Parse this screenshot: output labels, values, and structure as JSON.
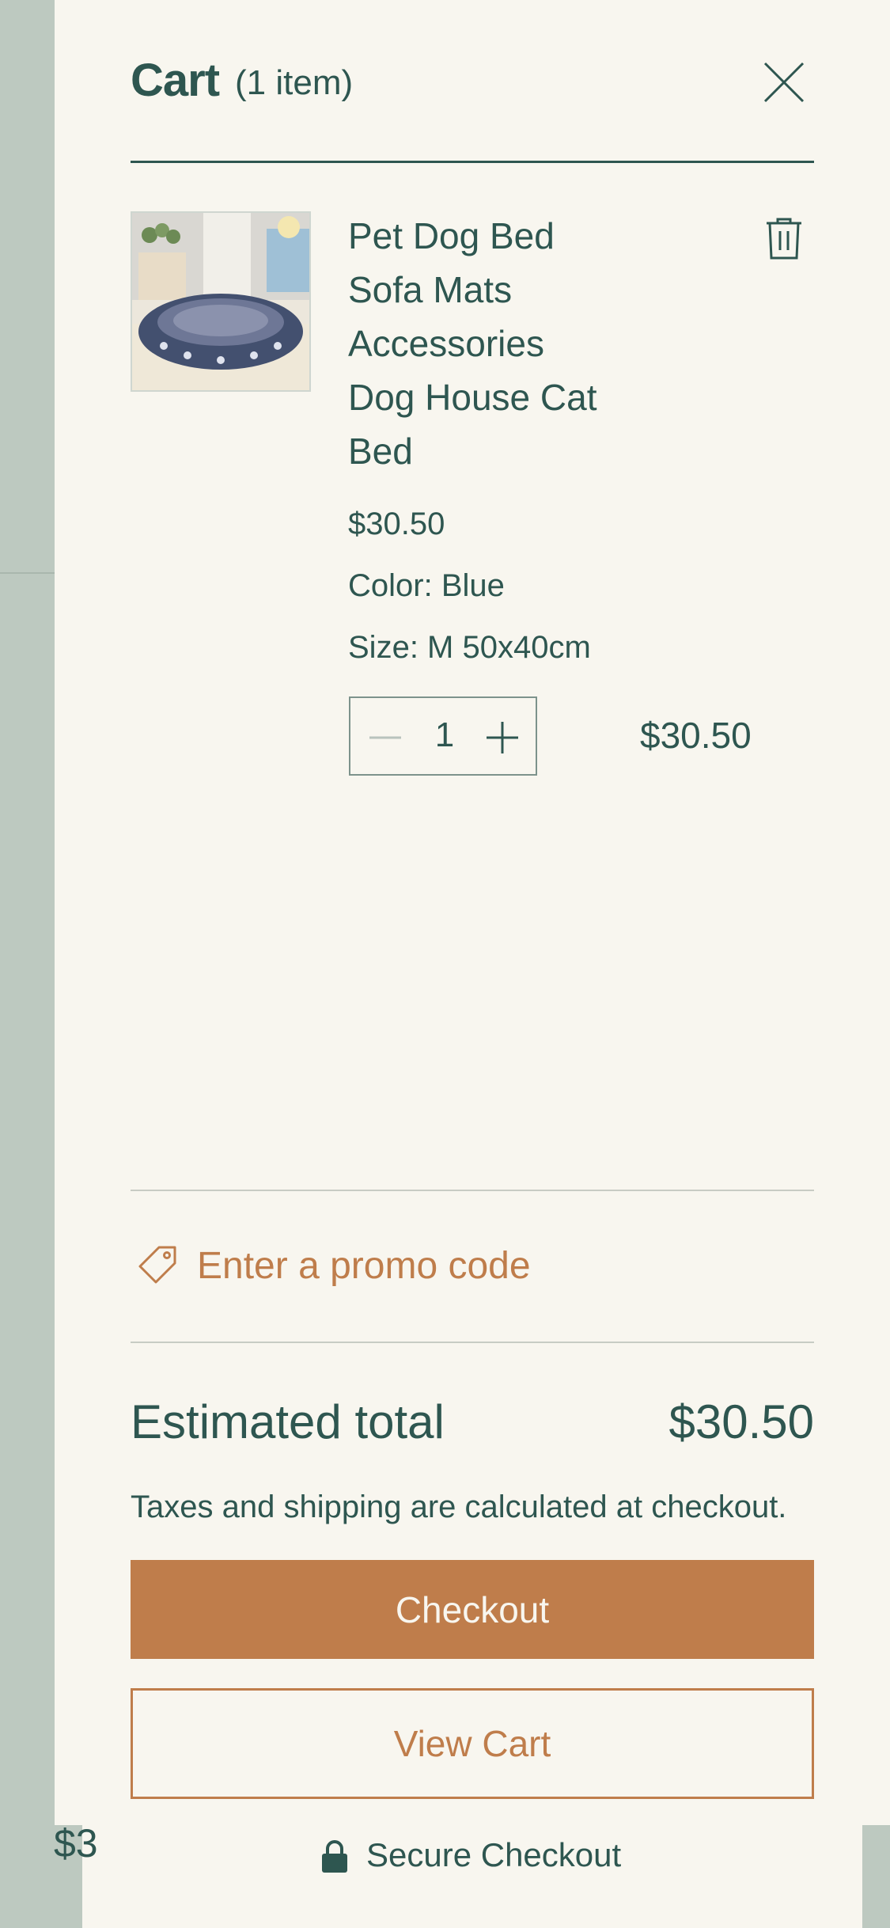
{
  "backdrop": {
    "partial_price": "$3"
  },
  "cart": {
    "title": "Cart",
    "count_label": "(1 item)"
  },
  "item": {
    "title": "Pet Dog Bed Sofa Mats Accessories Dog House Cat Bed",
    "price": "$30.50",
    "color": "Color: Blue",
    "size": "Size: M 50x40cm",
    "quantity": "1",
    "line_total": "$30.50"
  },
  "promo": {
    "label": "Enter a promo code"
  },
  "summary": {
    "estimated_label": "Estimated total",
    "estimated_value": "$30.50",
    "tax_note": "Taxes and shipping are calculated at checkout."
  },
  "actions": {
    "checkout": "Checkout",
    "view_cart": "View Cart",
    "secure": "Secure Checkout"
  },
  "icons": {
    "close": "close-icon",
    "trash": "trash-icon",
    "minus": "minus-icon",
    "plus": "plus-icon",
    "tag": "tag-icon",
    "lock": "lock-icon"
  },
  "colors": {
    "primary_text": "#2e5650",
    "accent": "#bf7d4b",
    "panel_bg": "#f8f6ef",
    "backdrop": "#bdc9c0"
  }
}
